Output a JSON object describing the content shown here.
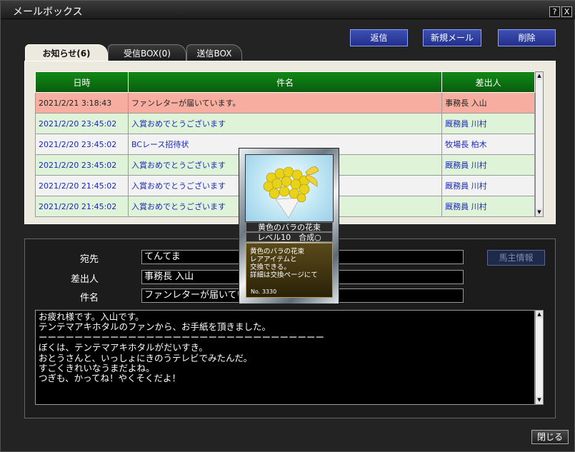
{
  "window": {
    "title": "メールボックス",
    "help_label": "?",
    "close_label": "X"
  },
  "actions": {
    "reply": "返信",
    "new_mail": "新規メール",
    "delete": "削除"
  },
  "tabs": [
    {
      "label": "お知らせ(6)",
      "active": true
    },
    {
      "label": "受信BOX(0)",
      "active": false
    },
    {
      "label": "送信BOX",
      "active": false
    }
  ],
  "table": {
    "headers": {
      "date": "日時",
      "subject": "件名",
      "sender": "差出人"
    },
    "rows": [
      {
        "date": "2021/2/21 3:18:43",
        "subject": "ファンレターが届いています。",
        "sender": "事務長 入山",
        "selected": true
      },
      {
        "date": "2021/2/20 23:45:02",
        "subject": "入賞おめでとうございます",
        "sender": "厩務員 川村"
      },
      {
        "date": "2021/2/20 23:45:02",
        "subject": "BCレース招待状",
        "sender": "牧場長 柏木"
      },
      {
        "date": "2021/2/20 23:45:02",
        "subject": "入賞おめでとうございます",
        "sender": "厩務員 川村"
      },
      {
        "date": "2021/2/20 21:45:02",
        "subject": "入賞おめでとうございます",
        "sender": "厩務員 川村"
      },
      {
        "date": "2021/2/20 21:45:02",
        "subject": "入賞おめでとうございます",
        "sender": "厩務員 川村"
      }
    ]
  },
  "detail": {
    "to_label": "宛先",
    "from_label": "差出人",
    "subject_label": "件名",
    "to_value": "てんてま",
    "from_value": "事務長 入山",
    "subject_value": "ファンレターが届いています。",
    "owner_info_button": "馬主情報"
  },
  "message": {
    "lines": [
      "お疲れ様です。入山です。",
      "テンテマアキホタルのファンから、お手紙を頂きました。",
      "",
      "ーーーーーーーーーーーーーーーーーーーーーーーーーーーーーーーー",
      "ぼくは、テンテマアキホタルがだいすき。",
      "おとうさんと、いっしょにきのうテレビでみたんだ。",
      "すごくきれいなうまだよね。",
      "つぎも、かってね！やくそくだよ！"
    ]
  },
  "item_card": {
    "name": "黄色のバラの花束",
    "level_line": "レベル10　合成○",
    "desc_lines": [
      "黄色のバラの花束",
      "レアアイテムと",
      "交換できる。",
      "詳細は交換ページにて"
    ],
    "number": "No. 3330"
  },
  "footer": {
    "close_label": "閉じる"
  },
  "colors": {
    "selected_row": "#f7aea0",
    "header_green": "#0f8a14",
    "link_blue": "#1a28b8",
    "button_blue": "#3d4fb5"
  }
}
